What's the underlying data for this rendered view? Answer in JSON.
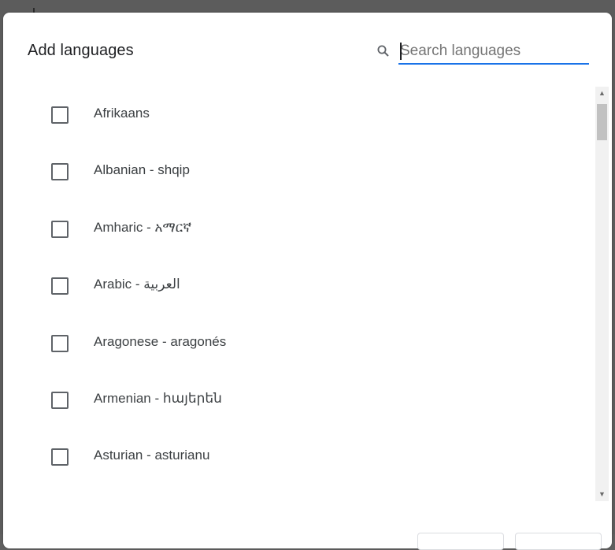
{
  "dialog": {
    "title": "Add languages"
  },
  "search": {
    "placeholder": "Search languages",
    "icon": "search-icon",
    "accent_color": "#1a73e8"
  },
  "languages": [
    {
      "label": "Afrikaans",
      "checked": false
    },
    {
      "label": "Albanian - shqip",
      "checked": false
    },
    {
      "label": "Amharic - አማርኛ",
      "checked": false
    },
    {
      "label": "Arabic - العربية",
      "checked": false
    },
    {
      "label": "Aragonese - aragonés",
      "checked": false
    },
    {
      "label": "Armenian - հայերեն",
      "checked": false
    },
    {
      "label": "Asturian - asturianu",
      "checked": false
    }
  ],
  "scrollbar": {
    "up_icon": "triangle-up-icon",
    "down_icon": "triangle-down-icon"
  }
}
